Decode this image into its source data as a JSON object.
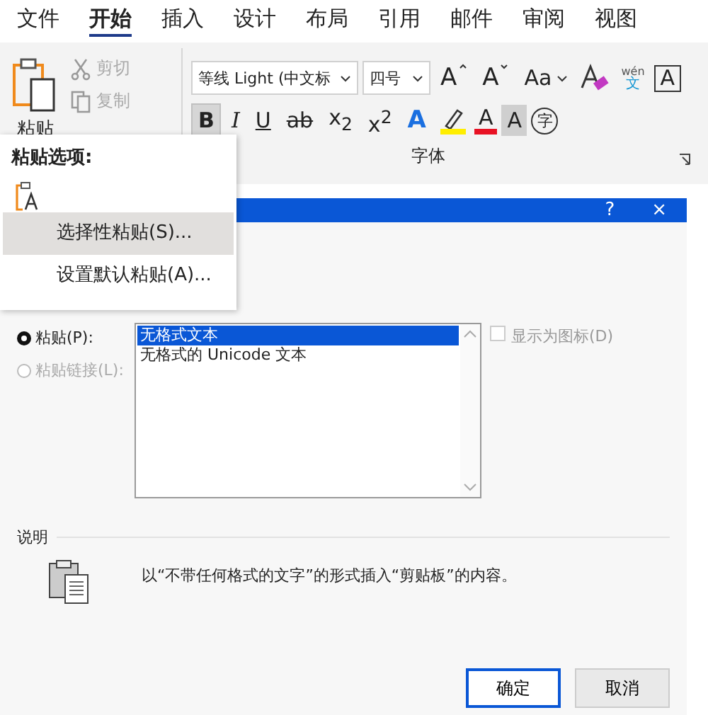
{
  "ribbon_tabs": [
    {
      "label": "文件",
      "selected": false
    },
    {
      "label": "开始",
      "selected": true
    },
    {
      "label": "插入",
      "selected": false
    },
    {
      "label": "设计",
      "selected": false
    },
    {
      "label": "布局",
      "selected": false
    },
    {
      "label": "引用",
      "selected": false
    },
    {
      "label": "邮件",
      "selected": false
    },
    {
      "label": "审阅",
      "selected": false
    },
    {
      "label": "视图",
      "selected": false
    }
  ],
  "clipboard_group": {
    "paste_label": "粘贴",
    "items": [
      {
        "kind": "cut",
        "label": "剪切",
        "disabled": true
      },
      {
        "kind": "copy",
        "label": "复制",
        "disabled": true
      }
    ]
  },
  "font_group": {
    "font_name": "等线 Light (中文标",
    "font_size": "四号",
    "label": "字体",
    "row_1": [
      {
        "kind": "grow",
        "label": "A"
      },
      {
        "kind": "shrink",
        "label": "A"
      },
      {
        "kind": "text",
        "label": "Aa",
        "dropdown": true,
        "selected": false
      },
      {
        "kind": "clear"
      },
      {
        "kind": "phonetic",
        "pinyin": "wén",
        "label": "文"
      },
      {
        "kind": "boxed",
        "label": "A"
      }
    ],
    "row_2": [
      {
        "kind": "text",
        "label": "B",
        "dropdown": false,
        "selected": true
      },
      {
        "kind": "italic",
        "label": "I"
      },
      {
        "kind": "underline",
        "label": "U"
      },
      {
        "kind": "strike",
        "label": "ab"
      },
      {
        "kind": "text",
        "label": "x$_{2}$",
        "dropdown": false,
        "selected": false
      },
      {
        "kind": "text",
        "label": "x$^{2}$",
        "dropdown": false,
        "selected": false
      },
      {
        "kind": "effects",
        "label": "A"
      },
      {
        "kind": "highlight",
        "color": "#ffee00"
      },
      {
        "kind": "fontcolor",
        "label": "A",
        "color": "#e81123"
      },
      {
        "kind": "shaded",
        "label": "A"
      },
      {
        "kind": "enclosed",
        "label": "字"
      }
    ]
  },
  "paste_menu": {
    "heading": "粘贴选项:",
    "items": [
      {
        "label": "选择性粘贴(S)...",
        "selected": true
      },
      {
        "label": "设置默认粘贴(A)...",
        "selected": false
      }
    ]
  },
  "dialog": {
    "title_buttons": [
      "?",
      "×"
    ],
    "paste_options": [
      {
        "label": "粘贴(P):",
        "selected": true,
        "disabled": false
      },
      {
        "label": "粘贴链接(L):",
        "selected": false,
        "disabled": true
      }
    ],
    "formats": [
      {
        "label": "无格式文本",
        "selected": true
      },
      {
        "label": "无格式的 Unicode 文本",
        "selected": false
      }
    ],
    "display_as_icon": {
      "label": "显示为图标(D)",
      "checked": false,
      "disabled": true
    },
    "result": {
      "heading": "说明",
      "text": "以“不带任何格式的文字”的形式插入“剪贴板”的内容。"
    },
    "buttons": [
      {
        "label": "确定",
        "default": true
      },
      {
        "label": "取消",
        "default": false
      }
    ]
  }
}
